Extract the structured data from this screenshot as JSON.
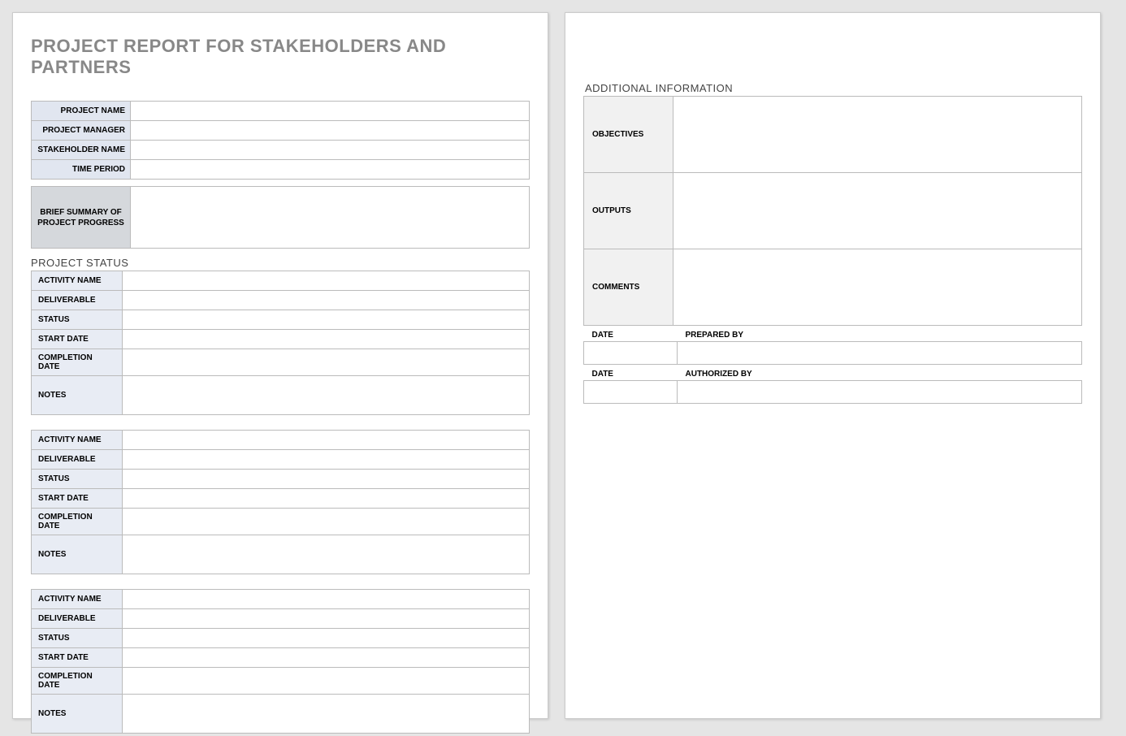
{
  "title": "PROJECT REPORT FOR STAKEHOLDERS AND PARTNERS",
  "header": {
    "rows": [
      {
        "label": "PROJECT NAME",
        "value": ""
      },
      {
        "label": "PROJECT MANAGER",
        "value": ""
      },
      {
        "label": "STAKEHOLDER NAME",
        "value": ""
      },
      {
        "label": "TIME PERIOD",
        "value": ""
      }
    ]
  },
  "summary": {
    "label": "BRIEF SUMMARY OF PROJECT PROGRESS",
    "value": ""
  },
  "status_section_label": "PROJECT STATUS",
  "activities": [
    {
      "rows": [
        {
          "label": "ACTIVITY NAME",
          "value": ""
        },
        {
          "label": "DELIVERABLE",
          "value": ""
        },
        {
          "label": "STATUS",
          "value": ""
        },
        {
          "label": "START DATE",
          "value": ""
        },
        {
          "label": "COMPLETION DATE",
          "value": ""
        },
        {
          "label": "NOTES",
          "value": "",
          "tall": true
        }
      ]
    },
    {
      "rows": [
        {
          "label": "ACTIVITY NAME",
          "value": ""
        },
        {
          "label": "DELIVERABLE",
          "value": ""
        },
        {
          "label": "STATUS",
          "value": ""
        },
        {
          "label": "START DATE",
          "value": ""
        },
        {
          "label": "COMPLETION DATE",
          "value": ""
        },
        {
          "label": "NOTES",
          "value": "",
          "tall": true
        }
      ]
    },
    {
      "rows": [
        {
          "label": "ACTIVITY NAME",
          "value": ""
        },
        {
          "label": "DELIVERABLE",
          "value": ""
        },
        {
          "label": "STATUS",
          "value": ""
        },
        {
          "label": "START DATE",
          "value": ""
        },
        {
          "label": "COMPLETION DATE",
          "value": ""
        },
        {
          "label": "NOTES",
          "value": "",
          "tall": true
        }
      ]
    }
  ],
  "additional_section_label": "ADDITIONAL INFORMATION",
  "additional": [
    {
      "label": "OBJECTIVES",
      "value": ""
    },
    {
      "label": "OUTPUTS",
      "value": ""
    },
    {
      "label": "COMMENTS",
      "value": ""
    }
  ],
  "signatures": [
    {
      "col1_header": "DATE",
      "col2_header": "PREPARED BY",
      "col1_value": "",
      "col2_value": ""
    },
    {
      "col1_header": "DATE",
      "col2_header": "AUTHORIZED BY",
      "col1_value": "",
      "col2_value": ""
    }
  ]
}
